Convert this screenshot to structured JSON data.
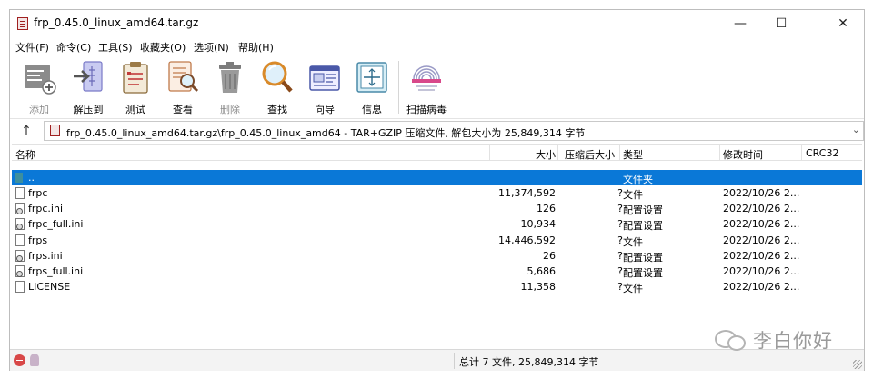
{
  "window": {
    "title": "frp_0.45.0_linux_amd64.tar.gz",
    "controls": {
      "minimize": "—",
      "maximize": "☐",
      "close": "✕"
    }
  },
  "menu": [
    "文件(F)",
    "命令(C)",
    "工具(S)",
    "收藏夹(O)",
    "选项(N)",
    "帮助(H)"
  ],
  "toolbar": [
    {
      "label": "添加",
      "icon": "add-icon",
      "enabled": false
    },
    {
      "label": "解压到",
      "icon": "extract-icon",
      "enabled": true
    },
    {
      "label": "测试",
      "icon": "test-icon",
      "enabled": true
    },
    {
      "label": "查看",
      "icon": "view-icon",
      "enabled": true
    },
    {
      "label": "删除",
      "icon": "trash-icon",
      "enabled": false
    },
    {
      "label": "查找",
      "icon": "find-icon",
      "enabled": true
    },
    {
      "label": "向导",
      "icon": "wizard-icon",
      "enabled": true
    },
    {
      "label": "信息",
      "icon": "info-icon",
      "enabled": true
    },
    {
      "label": "扫描病毒",
      "icon": "virus-scan-icon",
      "enabled": true
    }
  ],
  "address": {
    "up_label": "↑",
    "path": "frp_0.45.0_linux_amd64.tar.gz\\frp_0.45.0_linux_amd64 - TAR+GZIP 压缩文件, 解包大小为 25,849,314 字节",
    "dropdown": "⌄"
  },
  "columns": {
    "name": "名称",
    "size": "大小",
    "packed": "压缩后大小",
    "type": "类型",
    "modified": "修改时间",
    "crc": "CRC32",
    "sort_indicator": "^"
  },
  "files": [
    {
      "name": "..",
      "size": "",
      "packed": "",
      "type": "文件夹",
      "modified": "",
      "icon": "folder-icon",
      "selected": true
    },
    {
      "name": "frpc",
      "size": "11,374,592",
      "packed": "?",
      "type": "文件",
      "modified": "2022/10/26 2...",
      "icon": "file-icon",
      "selected": false
    },
    {
      "name": "frpc.ini",
      "size": "126",
      "packed": "?",
      "type": "配置设置",
      "modified": "2022/10/26 2...",
      "icon": "config-file-icon",
      "selected": false
    },
    {
      "name": "frpc_full.ini",
      "size": "10,934",
      "packed": "?",
      "type": "配置设置",
      "modified": "2022/10/26 2...",
      "icon": "config-file-icon",
      "selected": false
    },
    {
      "name": "frps",
      "size": "14,446,592",
      "packed": "?",
      "type": "文件",
      "modified": "2022/10/26 2...",
      "icon": "file-icon",
      "selected": false
    },
    {
      "name": "frps.ini",
      "size": "26",
      "packed": "?",
      "type": "配置设置",
      "modified": "2022/10/26 2...",
      "icon": "config-file-icon",
      "selected": false
    },
    {
      "name": "frps_full.ini",
      "size": "5,686",
      "packed": "?",
      "type": "配置设置",
      "modified": "2022/10/26 2...",
      "icon": "config-file-icon",
      "selected": false
    },
    {
      "name": "LICENSE",
      "size": "11,358",
      "packed": "?",
      "type": "文件",
      "modified": "2022/10/26 2...",
      "icon": "file-icon",
      "selected": false
    }
  ],
  "status": {
    "summary": "总计 7 文件, 25,849,314 字节"
  },
  "watermark": {
    "text": "李白你好"
  },
  "colors": {
    "selection": "#0a78d7",
    "disabled_text": "#8a8a8a"
  }
}
